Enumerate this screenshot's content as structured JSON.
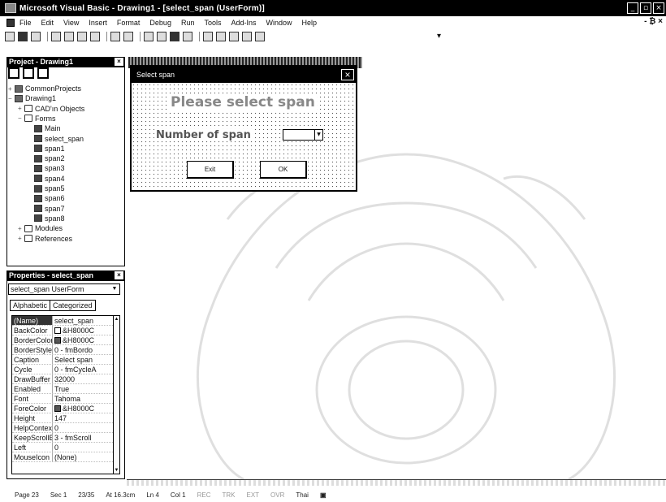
{
  "window": {
    "title": "Microsoft Visual Basic - Drawing1 - [select_span (UserForm)]",
    "min": "_",
    "restore": "▫",
    "close": "×"
  },
  "menu": {
    "items": [
      "File",
      "Edit",
      "View",
      "Insert",
      "Format",
      "Debug",
      "Run",
      "Tools",
      "Add-Ins",
      "Window",
      "Help"
    ],
    "right_controls": "- ₿ ×"
  },
  "toolbar": {
    "dropdown_glyph": "▾"
  },
  "project": {
    "title": "Project - Drawing1",
    "close": "×",
    "tree": [
      {
        "label": "CommonProjects",
        "toggle": "+",
        "type": "proj",
        "depth": 0
      },
      {
        "label": "Drawing1",
        "toggle": "−",
        "type": "proj",
        "depth": 0
      },
      {
        "label": "CAD'ın Objects",
        "toggle": "+",
        "type": "folder",
        "depth": 1
      },
      {
        "label": "Forms",
        "toggle": "−",
        "type": "folder",
        "depth": 1
      },
      {
        "label": "Main",
        "toggle": "",
        "type": "form",
        "depth": 2
      },
      {
        "label": "select_span",
        "toggle": "",
        "type": "form",
        "depth": 2
      },
      {
        "label": "span1",
        "toggle": "",
        "type": "form",
        "depth": 2
      },
      {
        "label": "span2",
        "toggle": "",
        "type": "form",
        "depth": 2
      },
      {
        "label": "span3",
        "toggle": "",
        "type": "form",
        "depth": 2
      },
      {
        "label": "span4",
        "toggle": "",
        "type": "form",
        "depth": 2
      },
      {
        "label": "span5",
        "toggle": "",
        "type": "form",
        "depth": 2
      },
      {
        "label": "span6",
        "toggle": "",
        "type": "form",
        "depth": 2
      },
      {
        "label": "span7",
        "toggle": "",
        "type": "form",
        "depth": 2
      },
      {
        "label": "span8",
        "toggle": "",
        "type": "form",
        "depth": 2
      },
      {
        "label": "Modules",
        "toggle": "+",
        "type": "folder",
        "depth": 1
      },
      {
        "label": "References",
        "toggle": "+",
        "type": "folder",
        "depth": 1
      }
    ]
  },
  "properties": {
    "title": "Properties - select_span",
    "close": "×",
    "object": "select_span UserForm",
    "tabs": [
      "Alphabetic",
      "Categorized"
    ],
    "rows": [
      {
        "name": "(Name)",
        "value": "select_span",
        "swatch": ""
      },
      {
        "name": "BackColor",
        "value": "&H8000C",
        "swatch": "#ffffff"
      },
      {
        "name": "BorderColor",
        "value": "&H8000C",
        "swatch": "#555555"
      },
      {
        "name": "BorderStyle",
        "value": "0 - fmBordo",
        "swatch": ""
      },
      {
        "name": "Caption",
        "value": "Select span",
        "swatch": ""
      },
      {
        "name": "Cycle",
        "value": "0 - fmCycleA",
        "swatch": ""
      },
      {
        "name": "DrawBuffer",
        "value": "32000",
        "swatch": ""
      },
      {
        "name": "Enabled",
        "value": "True",
        "swatch": ""
      },
      {
        "name": "Font",
        "value": "Tahoma",
        "swatch": ""
      },
      {
        "name": "ForeColor",
        "value": "&H8000C",
        "swatch": "#555555"
      },
      {
        "name": "Height",
        "value": "147",
        "swatch": ""
      },
      {
        "name": "HelpContextID",
        "value": "0",
        "swatch": ""
      },
      {
        "name": "KeepScrollBar",
        "value": "3 - fmScroll",
        "swatch": ""
      },
      {
        "name": "Left",
        "value": "0",
        "swatch": ""
      },
      {
        "name": "MouseIcon",
        "value": "(None)",
        "swatch": ""
      }
    ]
  },
  "userform": {
    "caption": "Select span",
    "close": "×",
    "heading": "Please select span",
    "label": "Number of span",
    "exit_button": "Exit",
    "ok_button": "OK"
  },
  "status": {
    "page": "Page 23",
    "sec": "Sec 1",
    "pages": "23/35",
    "at": "At 16.3cm",
    "ln": "Ln 4",
    "col": "Col 1",
    "rec": "REC",
    "trk": "TRK",
    "ext": "EXT",
    "ovr": "OVR",
    "lang": "Thai"
  }
}
